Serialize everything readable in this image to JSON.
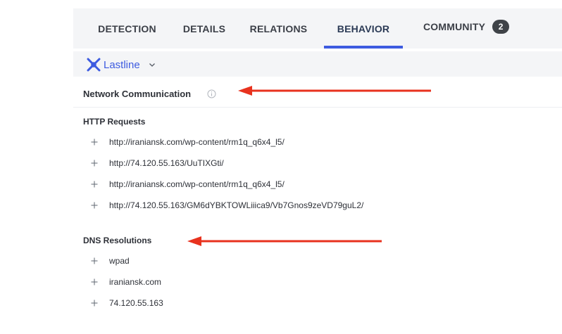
{
  "tabs": [
    {
      "label": "DETECTION"
    },
    {
      "label": "DETAILS"
    },
    {
      "label": "RELATIONS"
    },
    {
      "label": "BEHAVIOR"
    },
    {
      "label": "COMMUNITY",
      "badge": "2"
    }
  ],
  "active_tab": "BEHAVIOR",
  "sandbox": {
    "name": "Lastline"
  },
  "section": {
    "title": "Network Communication"
  },
  "http": {
    "title": "HTTP Requests",
    "items": [
      "http://iraniansk.com/wp-content/rm1q_q6x4_l5/",
      "http://74.120.55.163/UuTIXGti/",
      "http://iraniansk.com/wp-content/rm1q_q6x4_l5/",
      "http://74.120.55.163/GM6dYBKTOWLiiica9/Vb7Gnos9zeVD79guL2/"
    ]
  },
  "dns": {
    "title": "DNS Resolutions",
    "items": [
      "wpad",
      "iraniansk.com",
      "74.120.55.163"
    ]
  },
  "colors": {
    "accent": "#3d5be0",
    "annotation_arrow": "#e8321e",
    "badge": "#3f4348"
  }
}
